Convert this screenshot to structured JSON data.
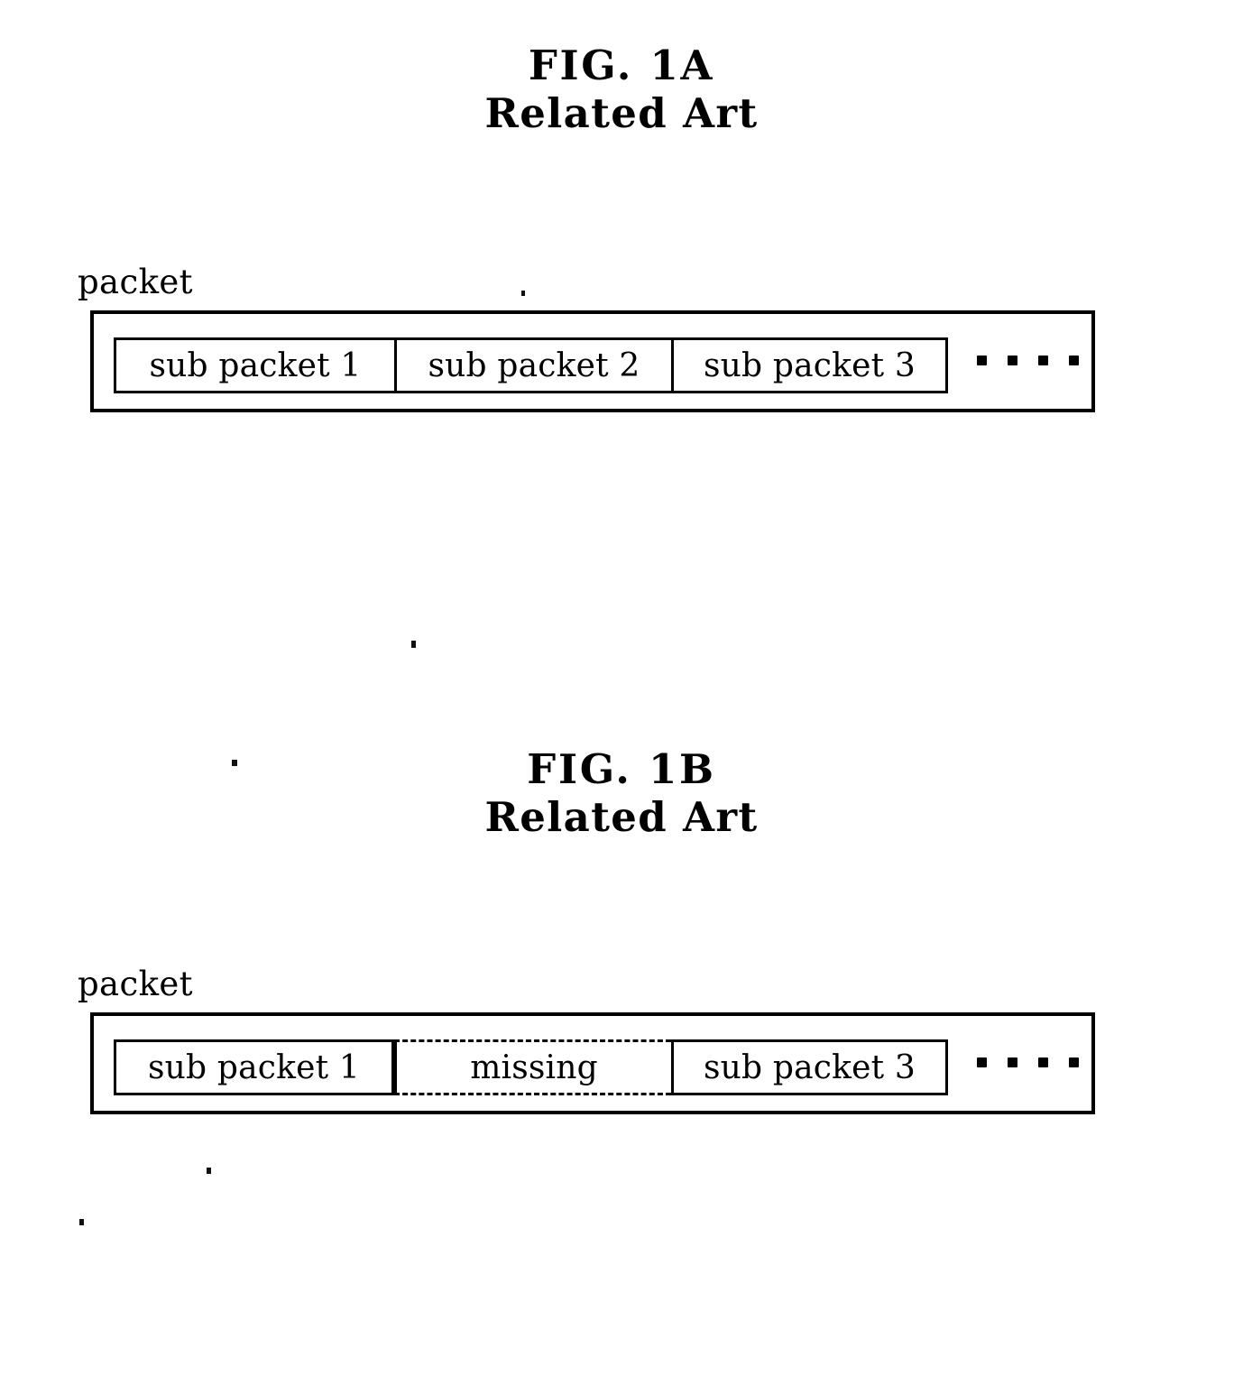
{
  "document": {
    "kind": "patent-drawing-sheet",
    "background_color": "#ffffff",
    "ink_color": "#000000"
  },
  "figures": [
    {
      "id": "fig-1a",
      "title_line1": "FIG. 1A",
      "title_line2": "Related Art",
      "caption": "packet",
      "cells": [
        {
          "label": "sub packet 1",
          "style": "solid"
        },
        {
          "label": "sub packet 2",
          "style": "solid"
        },
        {
          "label": "sub packet 3",
          "style": "solid"
        }
      ],
      "ellipsis_dots": 4
    },
    {
      "id": "fig-1b",
      "title_line1": "FIG. 1B",
      "title_line2": "Related Art",
      "caption": "packet",
      "cells": [
        {
          "label": "sub packet 1",
          "style": "solid"
        },
        {
          "label": "missing",
          "style": "dashed"
        },
        {
          "label": "sub packet 3",
          "style": "solid"
        }
      ],
      "ellipsis_dots": 4
    }
  ],
  "fig1a": {
    "title_line1": "FIG. 1A",
    "title_line2": "Related Art",
    "caption": "packet",
    "cell1": "sub packet 1",
    "cell2": "sub packet 2",
    "cell3": "sub packet 3"
  },
  "fig1b": {
    "title_line1": "FIG. 1B",
    "title_line2": "Related Art",
    "caption": "packet",
    "cell1": "sub packet 1",
    "cell2": "missing",
    "cell3": "sub packet 3"
  }
}
